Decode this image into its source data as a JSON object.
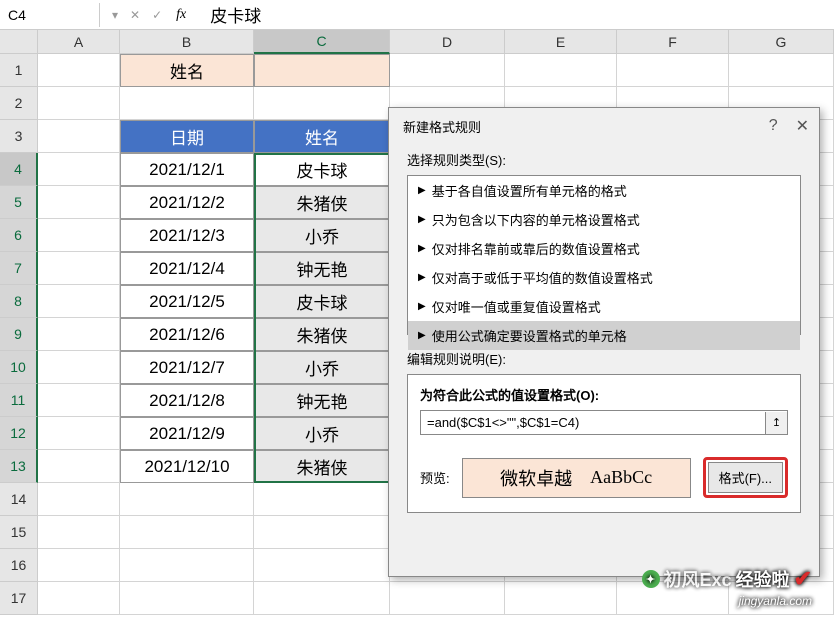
{
  "namebox": "C4",
  "formula_value": "皮卡球",
  "columns": [
    "A",
    "B",
    "C",
    "D",
    "E",
    "F",
    "G"
  ],
  "row_nums": [
    "1",
    "2",
    "3",
    "4",
    "5",
    "6",
    "7",
    "8",
    "9",
    "10",
    "11",
    "12",
    "13",
    "14",
    "15",
    "16",
    "17"
  ],
  "header_b1": "姓名",
  "table_headers": {
    "date": "日期",
    "name": "姓名"
  },
  "rows": [
    {
      "date": "2021/12/1",
      "name": "皮卡球"
    },
    {
      "date": "2021/12/2",
      "name": "朱猪侠"
    },
    {
      "date": "2021/12/3",
      "name": "小乔"
    },
    {
      "date": "2021/12/4",
      "name": "钟无艳"
    },
    {
      "date": "2021/12/5",
      "name": "皮卡球"
    },
    {
      "date": "2021/12/6",
      "name": "朱猪侠"
    },
    {
      "date": "2021/12/7",
      "name": "小乔"
    },
    {
      "date": "2021/12/8",
      "name": "钟无艳"
    },
    {
      "date": "2021/12/9",
      "name": "小乔"
    },
    {
      "date": "2021/12/10",
      "name": "朱猪侠"
    }
  ],
  "dialog": {
    "title": "新建格式规则",
    "help": "?",
    "close": "✕",
    "select_label": "选择规则类型(S):",
    "rules": [
      "基于各自值设置所有单元格的格式",
      "只为包含以下内容的单元格设置格式",
      "仅对排名靠前或靠后的数值设置格式",
      "仅对高于或低于平均值的数值设置格式",
      "仅对唯一值或重复值设置格式",
      "使用公式确定要设置格式的单元格"
    ],
    "edit_label": "编辑规则说明(E):",
    "formula_label": "为符合此公式的值设置格式(O):",
    "formula": "=and($C$1<>\"\",$C$1=C4)",
    "preview_label": "预览:",
    "preview_cn": "微软卓越",
    "preview_en": "AaBbCc",
    "format_btn": "格式(F)..."
  },
  "watermark": {
    "brand_prefix": "初风Exc",
    "brand": "经验啦",
    "url": "jingyanla.com"
  }
}
